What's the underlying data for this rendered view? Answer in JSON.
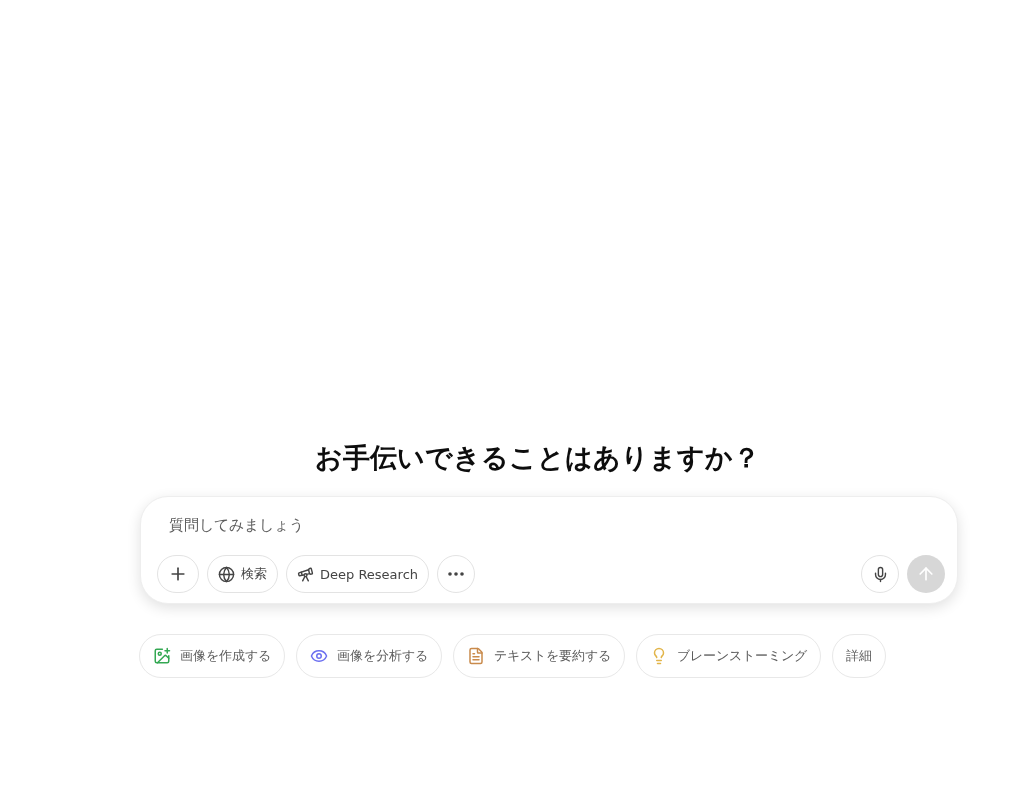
{
  "heading": "お手伝いできることはありますか？",
  "composer": {
    "placeholder": "質問してみましょう",
    "tools": [
      {
        "kind": "plus"
      },
      {
        "kind": "globe",
        "label": "検索"
      },
      {
        "kind": "telescope",
        "label": "Deep Research"
      },
      {
        "kind": "more"
      }
    ],
    "send_button": {
      "disabled": true
    }
  },
  "suggestions": [
    {
      "kind": "image",
      "label": "画像を作成する",
      "color": "#34a853"
    },
    {
      "kind": "eye",
      "label": "画像を分析する",
      "color": "#6b6ff0"
    },
    {
      "kind": "doc",
      "label": "テキストを要約する",
      "color": "#c98a4b"
    },
    {
      "kind": "bulb",
      "label": "ブレーンストーミング",
      "color": "#e2b54a"
    },
    {
      "kind": "none",
      "label": "詳細"
    }
  ]
}
